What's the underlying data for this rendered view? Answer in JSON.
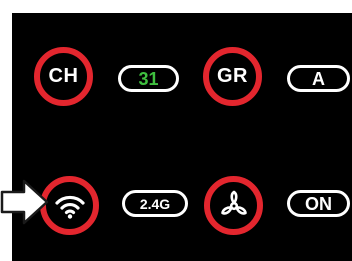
{
  "panel": {
    "channel": {
      "label": "CH",
      "value": "31",
      "value_color": "#3fbf3f"
    },
    "gear": {
      "label": "GR",
      "value": "A"
    },
    "wifi": {
      "icon": "wifi-icon",
      "value": "2.4G"
    },
    "fan": {
      "icon": "fan-icon",
      "value": "ON"
    }
  },
  "colors": {
    "ring": "#e3262e",
    "background": "#000000",
    "text": "#ffffff"
  },
  "pointer": {
    "icon": "pointer-arrow-icon"
  }
}
